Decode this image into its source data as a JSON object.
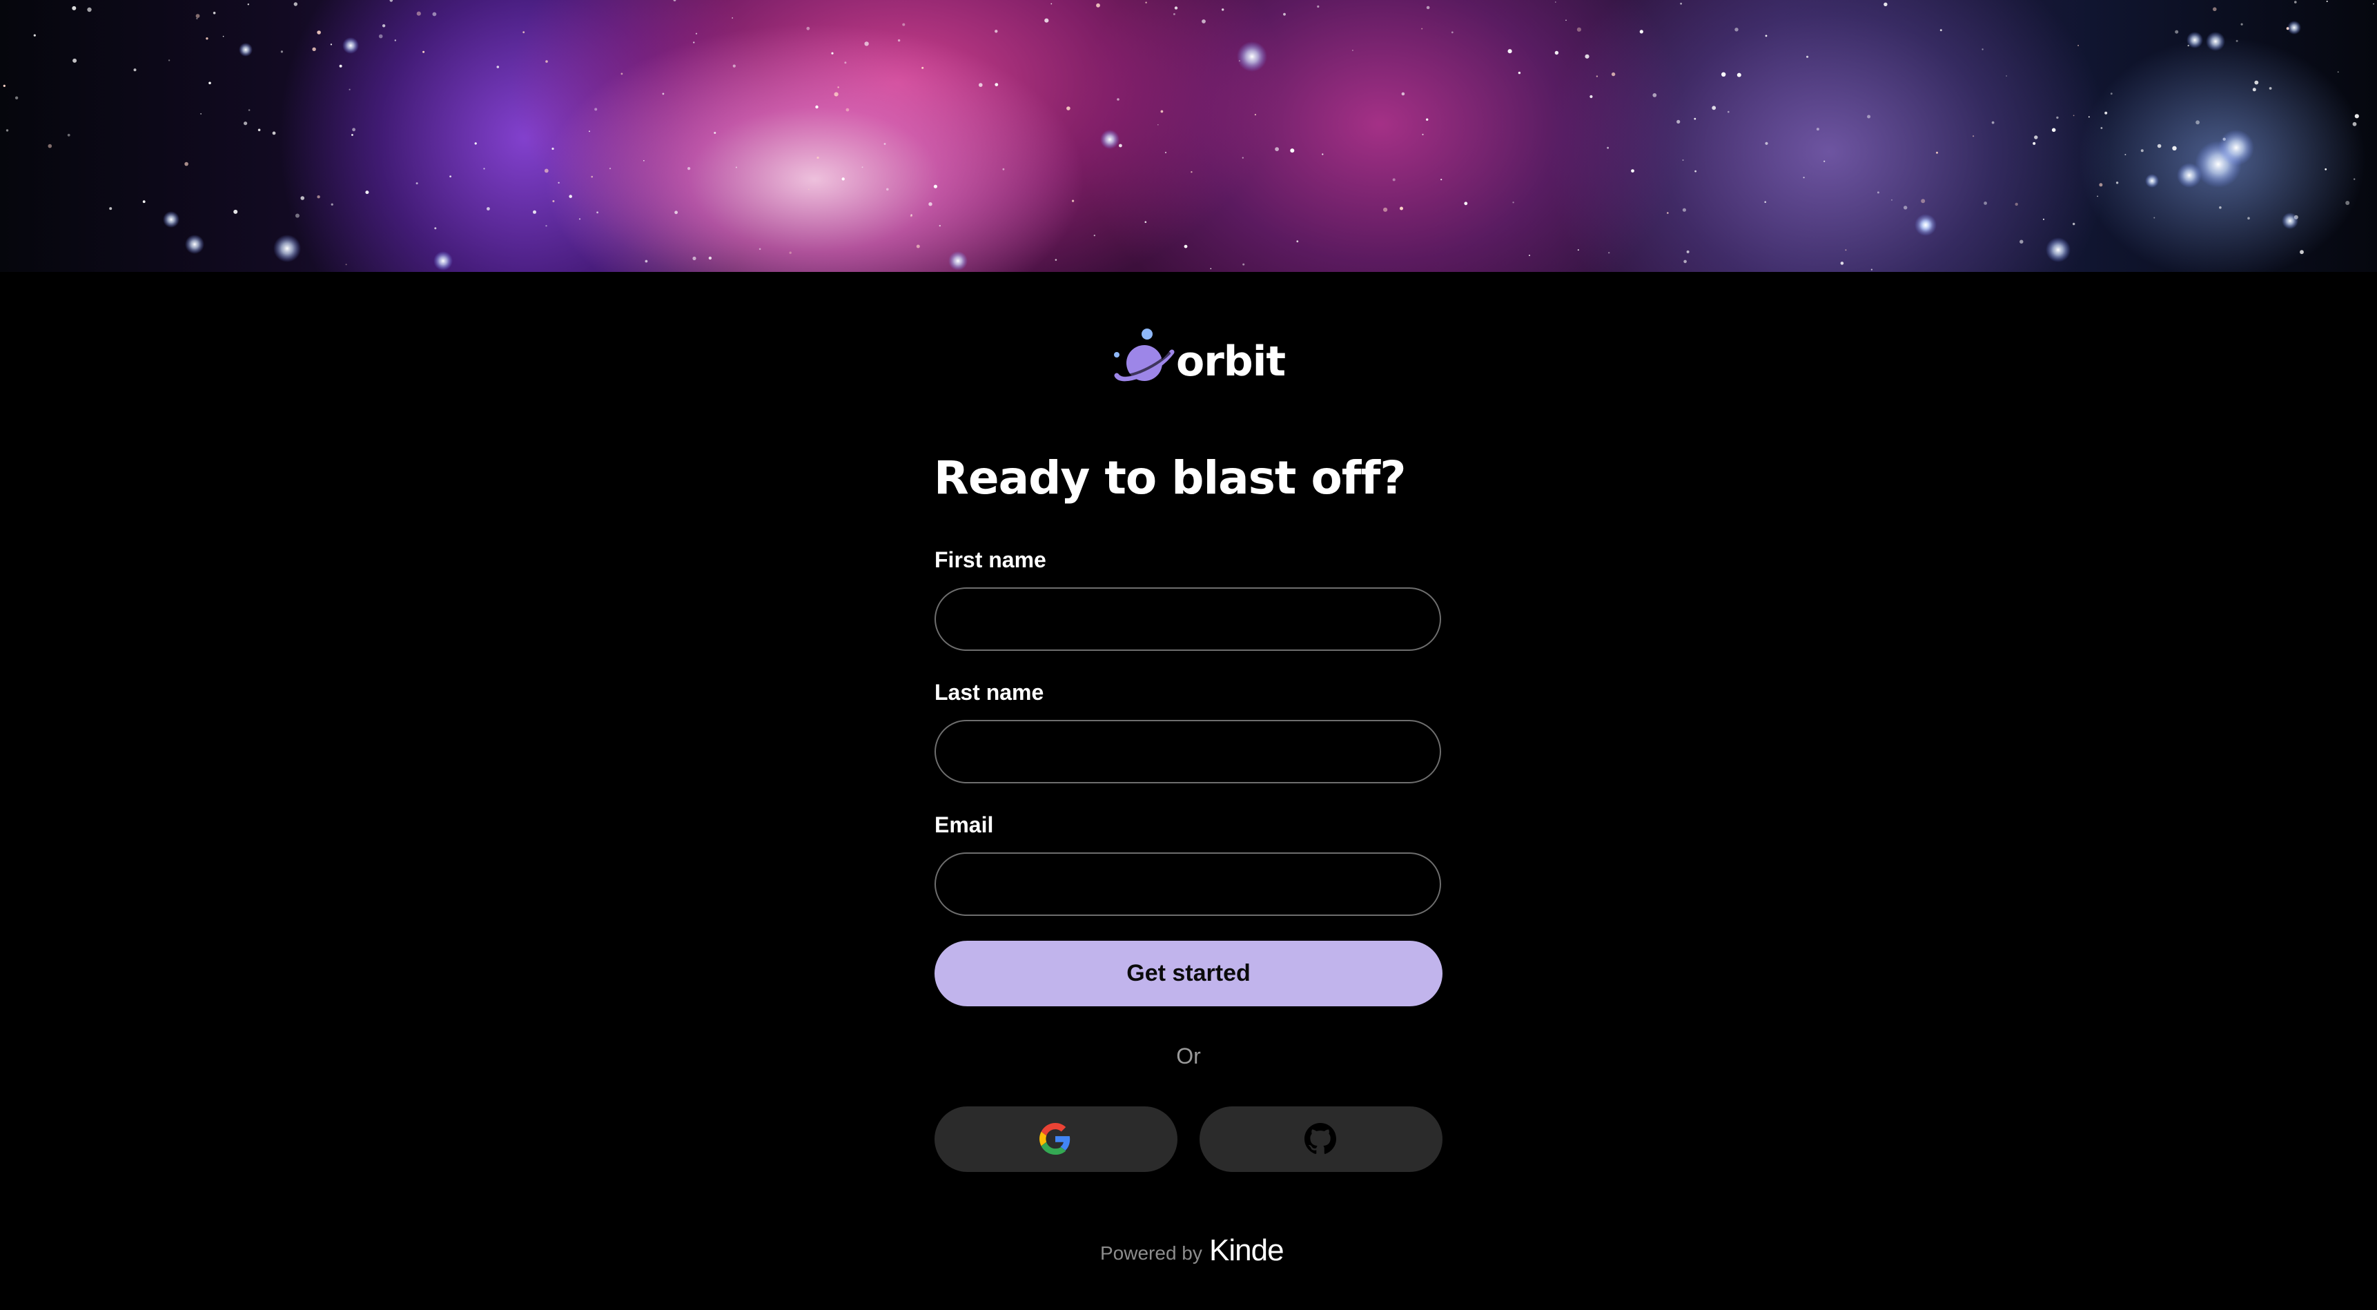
{
  "brand": {
    "name": "orbit",
    "accent_color": "#c1b4ec",
    "logo_icon": "planet-icon"
  },
  "form": {
    "heading": "Ready to blast off?",
    "fields": [
      {
        "label": "First name",
        "value": "",
        "placeholder": ""
      },
      {
        "label": "Last name",
        "value": "",
        "placeholder": ""
      },
      {
        "label": "Email",
        "value": "",
        "placeholder": ""
      }
    ],
    "submit_label": "Get started",
    "divider_text": "Or"
  },
  "social_logins": [
    {
      "provider_icon": "google-icon"
    },
    {
      "provider_icon": "github-icon"
    }
  ],
  "footer": {
    "powered_by_label": "Powered by",
    "powered_by_brand": "Kinde"
  },
  "colors": {
    "background": "#000000",
    "input_border": "#6e6e6e",
    "social_button_bg": "#2b2b2b",
    "muted_text": "#9a9a9a"
  }
}
